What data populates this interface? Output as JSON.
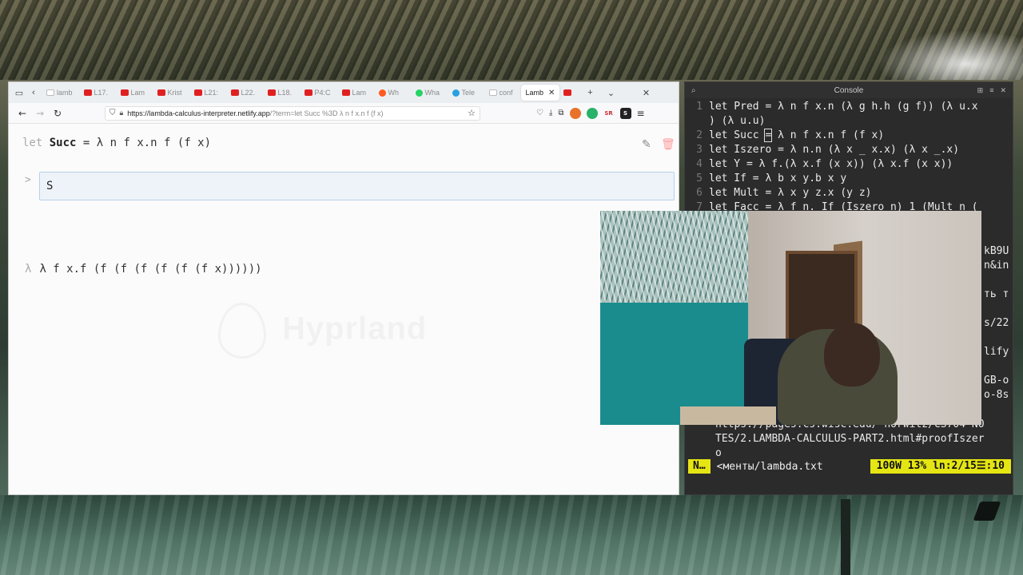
{
  "browser": {
    "tabs": [
      {
        "label": "lamb",
        "icon": "g"
      },
      {
        "label": "L17.",
        "icon": "yt"
      },
      {
        "label": "Lam",
        "icon": "yt"
      },
      {
        "label": "Krist",
        "icon": "yt"
      },
      {
        "label": "L21:",
        "icon": "yt"
      },
      {
        "label": "L22.",
        "icon": "yt"
      },
      {
        "label": "L18.",
        "icon": "yt"
      },
      {
        "label": "P4:C",
        "icon": "yt"
      },
      {
        "label": "Lam",
        "icon": "yt"
      },
      {
        "label": "Wh",
        "icon": "reddit"
      },
      {
        "label": "Wha",
        "icon": "wa"
      },
      {
        "label": "Tele",
        "icon": "tg"
      },
      {
        "label": "conf",
        "icon": "g"
      },
      {
        "label": "Lamb",
        "icon": "none",
        "active": true
      }
    ],
    "url_host": "https://lambda-calculus-interpreter.netlify.app",
    "url_rest": "/?term=let Succ %3D λ n f x.n f (f x)",
    "page": {
      "def_keyword": "let",
      "def_name": "Succ",
      "def_body": "= λ n f x.n f (f x)",
      "prompt": ">",
      "input_value": "S",
      "result_prefix": "λ",
      "result": "λ f x.f (f (f (f (f (f (f x))))))",
      "watermark": "Hyprland"
    }
  },
  "terminal": {
    "title": "Console",
    "lines": [
      {
        "num": "1",
        "text": "let Pred = λ n f x.n (λ g h.h (g f)) (λ u.x"
      },
      {
        "num": "",
        "text": ") (λ u.u)"
      },
      {
        "num": "2",
        "text": "let Succ = λ n f x.n f (f x)"
      },
      {
        "num": "3",
        "text": "let Iszero = λ n.n (λ x _ x.x) (λ x _.x)"
      },
      {
        "num": "4",
        "text": "let Y = λ f.(λ x.f (x x)) (λ x.f (x x))"
      },
      {
        "num": "5",
        "text": "let If = λ b x y.b x y"
      },
      {
        "num": "6",
        "text": "let Mult = λ x y z.x (y z)"
      },
      {
        "num": "7",
        "text": "let Facc = λ f n. If (Iszero n) 1 (Mult n ("
      }
    ],
    "right_fragments": [
      "kB9U",
      "n&in",
      "ть т",
      "s/22",
      "lify",
      "GB-o",
      "o-8s"
    ],
    "bottom_lines": [
      "https://pages.cs.wisc.edu/~horwitz/CS704-NO",
      "TES/2.LAMBDA-CALCULUS-PART2.html#proofIszer",
      "o"
    ],
    "status": {
      "mode": "N…",
      "file": "<менты/lambda.txt",
      "pos": "100W 13% ln:2/15☰:10"
    }
  }
}
